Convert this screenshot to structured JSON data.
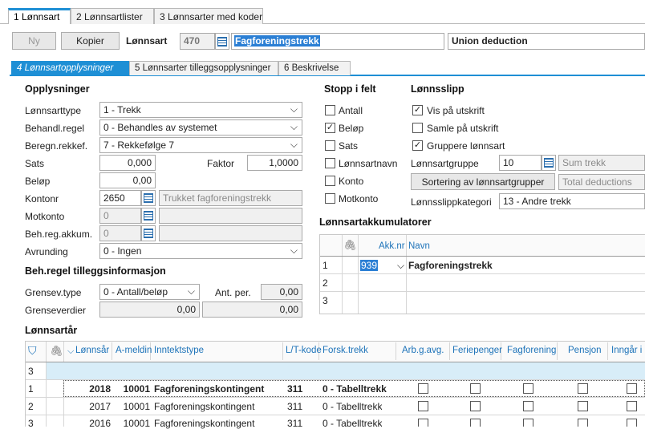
{
  "top_tabs": [
    "1 Lønnsart",
    "2 Lønnsartlister",
    "3 Lønnsarter med koder"
  ],
  "header": {
    "new_label": "Ny",
    "copy_label": "Kopier",
    "lonnsart_label": "Lønnsart",
    "lonnsart_nr": "470",
    "lonnsart_name": "Fagforeningstrekk",
    "english_name": "Union deduction"
  },
  "sub_tabs": [
    "4 Lønnsartopplysninger",
    "5 Lønnsarter tilleggsopplysninger",
    "6 Beskrivelse"
  ],
  "opplysninger": {
    "title": "Opplysninger",
    "lonnsarttype_label": "Lønnsarttype",
    "lonnsarttype": "1 - Trekk",
    "behandl_label": "Behandl.regel",
    "behandl": "0 - Behandles av systemet",
    "beregn_label": "Beregn.rekkef.",
    "beregn": "7 - Rekkefølge 7",
    "sats_label": "Sats",
    "sats": "0,000",
    "faktor_label": "Faktor",
    "faktor": "1,0000",
    "belop_label": "Beløp",
    "belop": "0,00",
    "kontonr_label": "Kontonr",
    "kontonr": "2650",
    "kontonr_name": "Trukket fagforeningstrekk",
    "motkonto_label": "Motkonto",
    "motkonto": "0",
    "behreg_label": "Beh.reg.akkum.",
    "behreg": "0",
    "avrunding_label": "Avrunding",
    "avrunding": "0 - Ingen"
  },
  "tillegg": {
    "title": "Beh.regel tilleggsinformasjon",
    "grensev_label": "Grensev.type",
    "grensev": "0 - Antall/beløp",
    "antper_label": "Ant. per.",
    "antper": "0,00",
    "grenseverdier_label": "Grenseverdier",
    "grense1": "0,00",
    "grense2": "0,00"
  },
  "stopp": {
    "title": "Stopp i felt",
    "items": [
      {
        "label": "Antall",
        "mark": ""
      },
      {
        "label": "Beløp",
        "mark": "✓"
      },
      {
        "label": "Sats",
        "mark": ""
      },
      {
        "label": "Lønnsartnavn",
        "mark": ""
      },
      {
        "label": "Konto",
        "mark": ""
      },
      {
        "label": "Motkonto",
        "mark": ""
      }
    ]
  },
  "lonnsslipp": {
    "title": "Lønnsslipp",
    "vis_label": "Vis på utskrift",
    "vis_mark": "✓",
    "samle_label": "Samle på utskrift",
    "samle_mark": "",
    "gruppere_label": "Gruppere lønnsart",
    "gruppere_mark": "✓",
    "gruppe_label": "Lønnsartgruppe",
    "gruppe": "10",
    "gruppe_name": "Sum trekk",
    "sortering_label": "Sortering av lønnsartgrupper",
    "sortering_name": "Total deductions",
    "kategori_label": "Lønnsslippkategori",
    "kategori": "13 - Andre trekk"
  },
  "akkumulatorer": {
    "title": "Lønnsartakkumulatorer",
    "col_akk": "Akk.nr",
    "col_navn": "Navn",
    "rows": [
      {
        "nr": "1",
        "akk": "939",
        "navn": "Fagforeningstrekk"
      },
      {
        "nr": "2",
        "akk": "",
        "navn": ""
      },
      {
        "nr": "3",
        "akk": "",
        "navn": ""
      }
    ]
  },
  "lonnsartar": {
    "title": "Lønnsartår",
    "headers": [
      "Lønnsår",
      "A-meldin",
      "Inntektstype",
      "L/T-kode",
      "Forsk.trekk",
      "Arb.g.avg.",
      "Feriepenger",
      "Fagforening",
      "Pensjon",
      "Inngår i g"
    ],
    "filter_row": "3",
    "rows": [
      {
        "nr": "1",
        "ar": "2018",
        "amld": "10001",
        "type": "Fagforeningskontingent",
        "lt": "311",
        "forsk": "0 - Tabelltrekk"
      },
      {
        "nr": "2",
        "ar": "2017",
        "amld": "10001",
        "type": "Fagforeningskontingent",
        "lt": "311",
        "forsk": "0 - Tabelltrekk"
      },
      {
        "nr": "3",
        "ar": "2016",
        "amld": "10001",
        "type": "Fagforeningskontingent",
        "lt": "311",
        "forsk": "0 - Tabelltrekk"
      }
    ]
  }
}
